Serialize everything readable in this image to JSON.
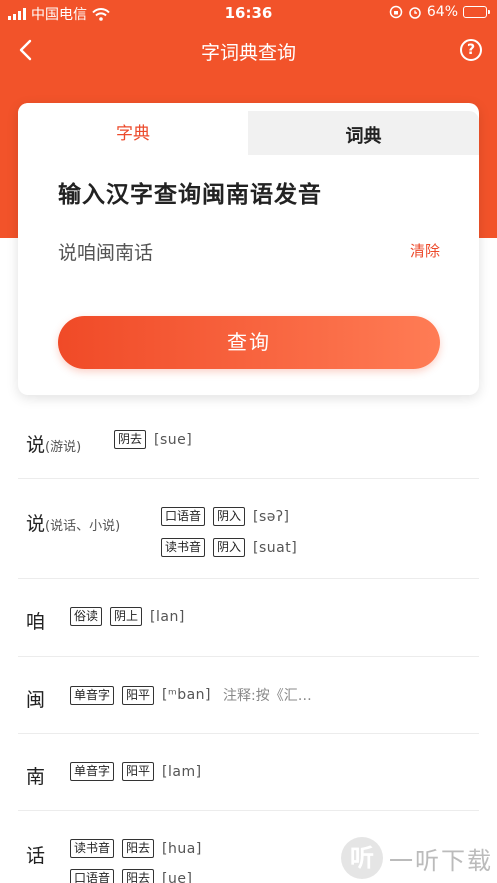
{
  "status_bar": {
    "carrier": "中国电信",
    "time": "16:36",
    "battery": "64%",
    "battery_level": 0.64
  },
  "nav": {
    "title": "字词典查询",
    "help_symbol": "?"
  },
  "tabs": [
    {
      "label": "字典",
      "active": true
    },
    {
      "label": "词典",
      "active": false
    }
  ],
  "search": {
    "heading": "输入汉字查询闽南语发音",
    "value": "说咱闽南话",
    "clear_label": "清除",
    "submit_label": "查询"
  },
  "results": [
    {
      "char": "说",
      "note": "(游说)",
      "lines": [
        {
          "tags": [
            "阴去"
          ],
          "pron": "[sue]"
        }
      ]
    },
    {
      "char": "说",
      "note": "(说话、小说)",
      "lines": [
        {
          "tags": [
            "口语音",
            "阴入"
          ],
          "pron": "[səʔ]"
        },
        {
          "tags": [
            "读书音",
            "阴入"
          ],
          "pron": "[suat]"
        }
      ]
    },
    {
      "char": "咱",
      "lines": [
        {
          "tags": [
            "俗读",
            "阴上"
          ],
          "pron": "[lan]"
        }
      ]
    },
    {
      "char": "闽",
      "lines": [
        {
          "tags": [
            "单音字",
            "阳平"
          ],
          "pron": "[ᵐban]",
          "extra": "注释:按《汇…"
        }
      ]
    },
    {
      "char": "南",
      "lines": [
        {
          "tags": [
            "单音字",
            "阳平"
          ],
          "pron": "[lam]"
        }
      ]
    },
    {
      "char": "话",
      "lines": [
        {
          "tags": [
            "读书音",
            "阳去"
          ],
          "pron": "[hua]"
        },
        {
          "tags": [
            "口语音",
            "阳去"
          ],
          "pron": "[ue]"
        }
      ]
    }
  ],
  "watermark": {
    "badge": "听",
    "text": "一听下载"
  },
  "colors": {
    "accent": "#f2532a",
    "accent_text": "#ec4a2b"
  }
}
